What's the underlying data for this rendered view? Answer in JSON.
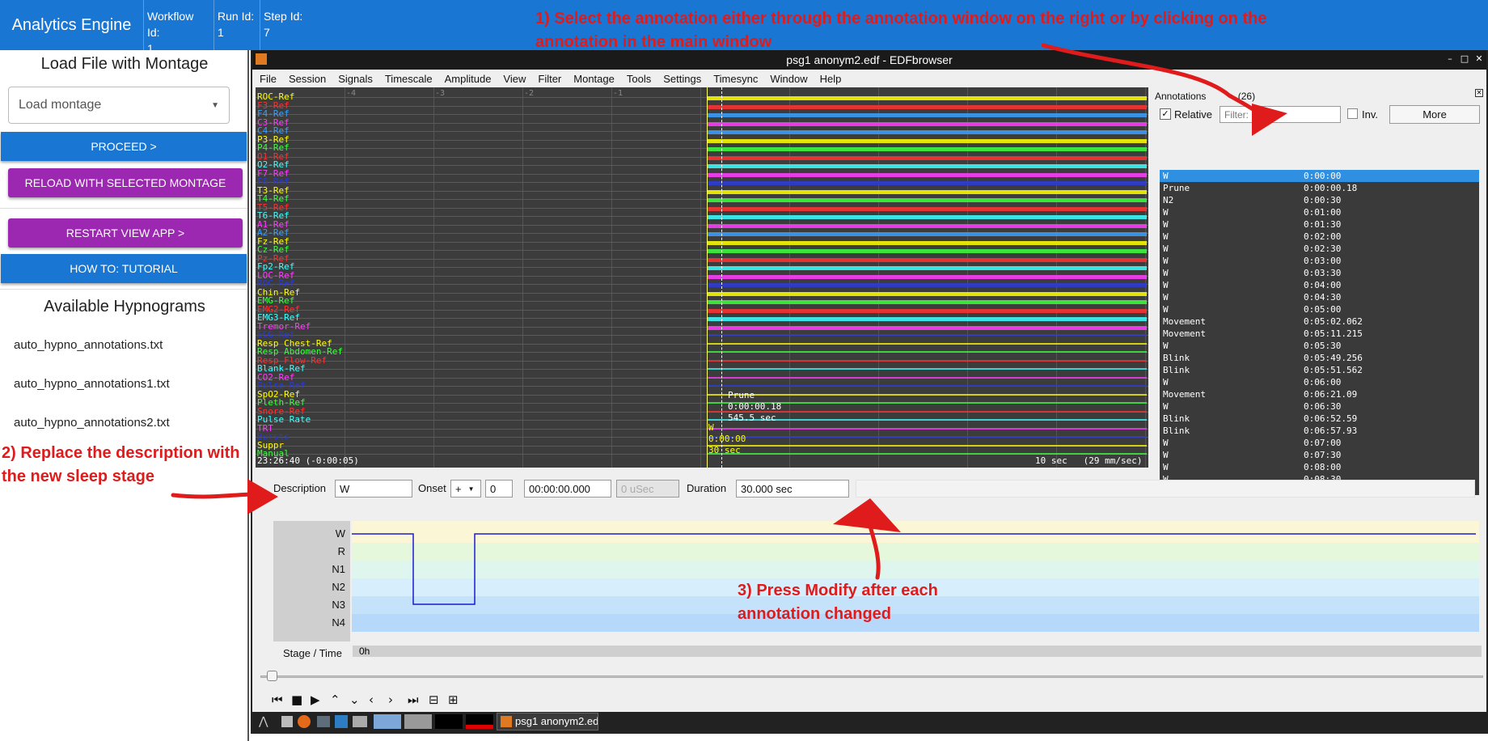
{
  "header": {
    "brand": "Analytics Engine",
    "workflow_label": "Workflow Id:",
    "workflow_value": "1",
    "run_label": "Run Id:",
    "run_value": "1",
    "step_label": "Step Id:",
    "step_value": "7",
    "color": "#1976d2"
  },
  "instructions": {
    "step1": "1) Select the annotation  either through the annotation window on the right or by clicking on the annotation in the main window",
    "step2": "2) Replace the description with the new sleep stage",
    "step3": "3) Press Modify after each annotation changed",
    "color": "#e01b1b"
  },
  "left_panel": {
    "load_title": "Load File with Montage",
    "montage_placeholder": "Load montage",
    "proceed": "PROCEED >",
    "reload": "RELOAD WITH SELECTED MONTAGE",
    "restart": "RESTART VIEW APP >",
    "howto": "HOW TO: TUTORIAL",
    "hypno_title": "Available Hypnograms",
    "hypnograms": [
      "auto_hypno_annotations.txt",
      "auto_hypno_annotations1.txt",
      "auto_hypno_annotations2.txt"
    ]
  },
  "edf": {
    "title": "psg1 anonym2.edf - EDFbrowser",
    "menu": [
      "File",
      "Session",
      "Signals",
      "Timescale",
      "Amplitude",
      "View",
      "Filter",
      "Montage",
      "Tools",
      "Settings",
      "Timesync",
      "Window",
      "Help"
    ],
    "time_label": "23:26:40 (-0:00:05)",
    "scale_label": "10 sec   (29 mm/sec)",
    "neg_ticks": [
      "-4",
      "-3",
      "-2",
      "-1"
    ],
    "signals": [
      {
        "name": "ROC-Ref",
        "color": "#ffff00"
      },
      {
        "name": "F3-Ref",
        "color": "#ff3030"
      },
      {
        "name": "F4-Ref",
        "color": "#3aa0ff"
      },
      {
        "name": "C3-Ref",
        "color": "#ff3cff"
      },
      {
        "name": "C4-Ref",
        "color": "#3aa0ff"
      },
      {
        "name": "P3-Ref",
        "color": "#ffff00"
      },
      {
        "name": "P4-Ref",
        "color": "#3cff3c"
      },
      {
        "name": "O1-Ref",
        "color": "#ff3030"
      },
      {
        "name": "O2-Ref",
        "color": "#3cffff"
      },
      {
        "name": "F7-Ref",
        "color": "#ff3cff"
      },
      {
        "name": "F8-Ref",
        "color": "#2a3ad8"
      },
      {
        "name": "T3-Ref",
        "color": "#ffff00"
      },
      {
        "name": "T4-Ref",
        "color": "#3cff3c"
      },
      {
        "name": "T5-Ref",
        "color": "#ff3030"
      },
      {
        "name": "T6-Ref",
        "color": "#3cffff"
      },
      {
        "name": "A1-Ref",
        "color": "#ff3cff"
      },
      {
        "name": "A2-Ref",
        "color": "#3aa0ff"
      },
      {
        "name": "Fz-Ref",
        "color": "#ffff00"
      },
      {
        "name": "Cz-Ref",
        "color": "#3cff3c"
      },
      {
        "name": "Pz-Ref",
        "color": "#ff3030"
      },
      {
        "name": "Fp2-Ref",
        "color": "#3cffff"
      },
      {
        "name": "LOC-Ref",
        "color": "#ff3cff"
      },
      {
        "name": "ROC-Ref",
        "color": "#2a3ad8"
      },
      {
        "name": "Chin-Ref",
        "color": "#ffff00"
      },
      {
        "name": "EMG-Ref",
        "color": "#3cff3c"
      },
      {
        "name": "EMG2-Ref",
        "color": "#ff3030"
      },
      {
        "name": "EMG3-Ref",
        "color": "#3cffff"
      },
      {
        "name": "Tremor-Ref",
        "color": "#ff3cff"
      },
      {
        "name": "ECG-Ref",
        "color": "#2a3ad8"
      },
      {
        "name": "Resp Chest-Ref",
        "color": "#ffff00"
      },
      {
        "name": "Resp Abdomen-Ref",
        "color": "#3cff3c"
      },
      {
        "name": "Resp Flow-Ref",
        "color": "#ff3030"
      },
      {
        "name": "Blank-Ref",
        "color": "#3cffff"
      },
      {
        "name": "CO2-Ref",
        "color": "#ff3cff"
      },
      {
        "name": "Pulse-Ref",
        "color": "#2a3ad8"
      },
      {
        "name": "SpO2-Ref",
        "color": "#ffff00"
      },
      {
        "name": "Pleth-Ref",
        "color": "#3cff3c"
      },
      {
        "name": "Snore-Ref",
        "color": "#ff3030"
      },
      {
        "name": "Pulse Rate",
        "color": "#3cffff"
      },
      {
        "name": "TRT",
        "color": "#ff3cff"
      },
      {
        "name": "Bursts",
        "color": "#2a3ad8"
      },
      {
        "name": "Suppr",
        "color": "#ffff00"
      },
      {
        "name": "Manual",
        "color": "#3cff3c"
      }
    ],
    "inline_annot": {
      "desc": "Prune",
      "time": "0:00:00.18",
      "dur": "545.5 sec"
    },
    "inline_w": {
      "desc": "W",
      "time": "0:00:00",
      "dur": "30 sec"
    }
  },
  "annotations": {
    "title": "Annotations",
    "count": "(26)",
    "relative": "Relative",
    "filter_label": "Filter:",
    "inv": "Inv.",
    "more": "More",
    "rows": [
      {
        "desc": "W",
        "time": "0:00:00"
      },
      {
        "desc": "Prune",
        "time": "0:00:00.18"
      },
      {
        "desc": "N2",
        "time": "0:00:30"
      },
      {
        "desc": "W",
        "time": "0:01:00"
      },
      {
        "desc": "W",
        "time": "0:01:30"
      },
      {
        "desc": "W",
        "time": "0:02:00"
      },
      {
        "desc": "W",
        "time": "0:02:30"
      },
      {
        "desc": "W",
        "time": "0:03:00"
      },
      {
        "desc": "W",
        "time": "0:03:30"
      },
      {
        "desc": "W",
        "time": "0:04:00"
      },
      {
        "desc": "W",
        "time": "0:04:30"
      },
      {
        "desc": "W",
        "time": "0:05:00"
      },
      {
        "desc": "Movement",
        "time": "0:05:02.062"
      },
      {
        "desc": "Movement",
        "time": "0:05:11.215"
      },
      {
        "desc": "W",
        "time": "0:05:30"
      },
      {
        "desc": "Blink",
        "time": "0:05:49.256"
      },
      {
        "desc": "Blink",
        "time": "0:05:51.562"
      },
      {
        "desc": "W",
        "time": "0:06:00"
      },
      {
        "desc": "Movement",
        "time": "0:06:21.09"
      },
      {
        "desc": "W",
        "time": "0:06:30"
      },
      {
        "desc": "Blink",
        "time": "0:06:52.59"
      },
      {
        "desc": "Blink",
        "time": "0:06:57.93"
      },
      {
        "desc": "W",
        "time": "0:07:00"
      },
      {
        "desc": "W",
        "time": "0:07:30"
      },
      {
        "desc": "W",
        "time": "0:08:00"
      },
      {
        "desc": "W",
        "time": "0:08:30"
      }
    ]
  },
  "editor": {
    "desc_label": "Description",
    "desc_value": "W",
    "onset_label": "Onset",
    "onset_sign": "+",
    "onset_days": "0",
    "onset_time": "00:00:00.000",
    "onset_usec": "0 uSec",
    "duration_label": "Duration",
    "duration_value": "30.000 sec"
  },
  "hypnogram": {
    "stages": [
      "W",
      "R",
      "N1",
      "N2",
      "N3",
      "N4"
    ],
    "axis_label": "Stage / Time",
    "axis_value": "0h"
  }
}
